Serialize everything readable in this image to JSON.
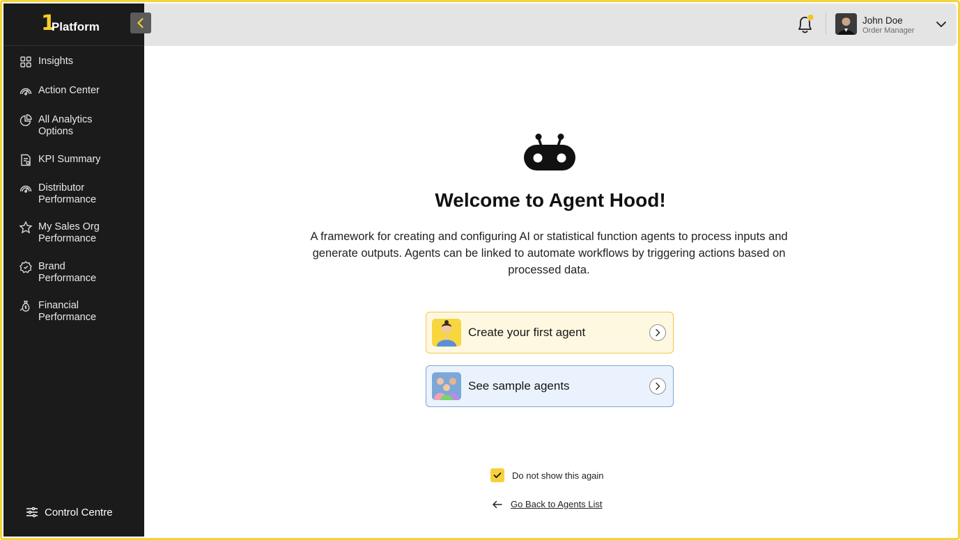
{
  "brand": {
    "logo_mark": "1",
    "logo_text": "Platform",
    "accent": "#f5cf2a"
  },
  "sidebar": {
    "items": [
      {
        "label": "Insights",
        "icon": "grid-icon"
      },
      {
        "label": "Action Center",
        "icon": "gauge-icon"
      },
      {
        "label": "All Analytics Options",
        "icon": "pie-chart-icon"
      },
      {
        "label": "KPI Summary",
        "icon": "report-icon"
      },
      {
        "label": "Distributor Performance",
        "icon": "gauge-icon"
      },
      {
        "label": "My Sales Org Performance",
        "icon": "star-icon"
      },
      {
        "label": "Brand Performance",
        "icon": "brand-badge-icon"
      },
      {
        "label": "Financial Performance",
        "icon": "money-bag-icon"
      }
    ],
    "control_centre": "Control Centre"
  },
  "header": {
    "user": {
      "name": "John Doe",
      "role": "Order Manager"
    },
    "notification_dot_color": "#f5c518"
  },
  "main": {
    "title": "Welcome to Agent Hood!",
    "description": "A framework for creating and configuring AI or statistical function agents to process inputs and generate outputs. Agents can be linked to automate workflows by triggering actions based on processed data.",
    "cards": [
      {
        "label": "Create your first agent"
      },
      {
        "label": "See sample agents"
      }
    ],
    "dont_show_label": "Do not show this again",
    "dont_show_checked": true,
    "back_link": "Go Back to Agents List"
  }
}
